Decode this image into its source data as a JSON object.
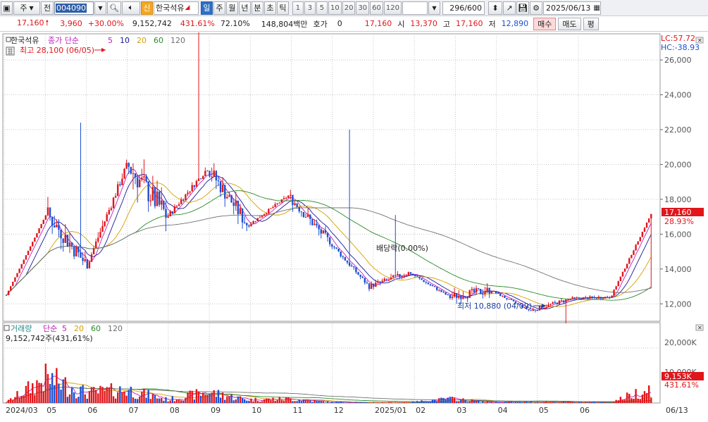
{
  "toolbar": {
    "type_label": "주",
    "front_label": "전",
    "code": "004090",
    "credit_badge": "신",
    "stock_name": "한국석유",
    "periods": [
      "일",
      "주",
      "월",
      "년",
      "분",
      "초",
      "틱"
    ],
    "selected_period": "일",
    "intervals": [
      "1",
      "3",
      "5",
      "10",
      "20",
      "30",
      "60",
      "120"
    ],
    "count": "296/600",
    "date": "2025/06/13"
  },
  "infobar": {
    "price": "17,160",
    "change": "3,960",
    "change_pct": "+30.00%",
    "volume": "9,152,742",
    "volume_pct": "431.61%",
    "rate": "72.10%",
    "amount": "148,804백만",
    "quote_label": "호가",
    "quote_value": "0",
    "quote_price": "17,160",
    "open_label": "시",
    "open": "13,370",
    "high_label": "고",
    "high": "17,160",
    "low_label": "저",
    "low": "12,890",
    "buy_label": "매수",
    "sell_label": "매도",
    "eval_label": "평"
  },
  "price_panel": {
    "legend_name": "한국석유",
    "legend_type": "종가 단순",
    "ma_periods": [
      "5",
      "10",
      "20",
      "60",
      "120"
    ],
    "ma_colors": [
      "#c020c0",
      "#1a1a9a",
      "#d4a000",
      "#2a8a2a",
      "#707070"
    ],
    "high_note": "최고 28,100 (06/05)",
    "low_note": "최저 10,880 (04/09)",
    "dividend_note": "배당락(0.00%)",
    "lc": "LC:57.72",
    "hc": "HC:-38.93",
    "last_price": "17,160",
    "last_pct": "28.93%",
    "y_ticks": [
      "26,000",
      "24,000",
      "22,000",
      "20,000",
      "18,000",
      "16,000",
      "14,000",
      "12,000"
    ]
  },
  "volume_panel": {
    "legend_name": "거래량",
    "legend_type": "단순",
    "ma_periods": [
      "5",
      "20",
      "60",
      "120"
    ],
    "volume_value": "9,152,742주(431,61%)",
    "y_tick": "20,000K",
    "hidden_tick": "10,000K",
    "last_value": "9,153K",
    "last_pct": "431.61%"
  },
  "x_axis": [
    "2024/03",
    "05",
    "06",
    "07",
    "08",
    "09",
    "10",
    "11",
    "12",
    "2025/01",
    "02",
    "03",
    "04",
    "05",
    "06",
    "06/13"
  ],
  "colors": {
    "up": "#e0161b",
    "down": "#1c4fd0",
    "grid": "#c8c8c8"
  },
  "chart_data": {
    "type": "candlestick",
    "x": [
      "2024/03",
      "04",
      "05",
      "06",
      "07",
      "08",
      "09",
      "10",
      "11",
      "12",
      "2025/01",
      "02",
      "03",
      "04",
      "05",
      "06",
      "06/13"
    ],
    "close": [
      12500,
      17200,
      14200,
      20000,
      17000,
      19800,
      16500,
      18200,
      15600,
      13000,
      13800,
      12400,
      12800,
      11600,
      12300,
      12400,
      17160
    ],
    "high": [
      12600,
      22400,
      18000,
      28100,
      18400,
      24600,
      17800,
      22000,
      17000,
      15200,
      14200,
      17100,
      13400,
      13100,
      13600,
      12800,
      17160
    ],
    "low": [
      12300,
      12400,
      13200,
      13400,
      15300,
      15600,
      16000,
      16400,
      14400,
      12000,
      12800,
      12200,
      12200,
      10880,
      12000,
      12000,
      12890
    ],
    "volume_k": [
      500,
      15000,
      6000,
      8000,
      2000,
      6500,
      2000,
      2500,
      600,
      300,
      400,
      2500,
      500,
      600,
      500,
      400,
      9153
    ],
    "ylim": [
      11000,
      27500
    ],
    "volume_ylim": [
      0,
      22000
    ]
  }
}
